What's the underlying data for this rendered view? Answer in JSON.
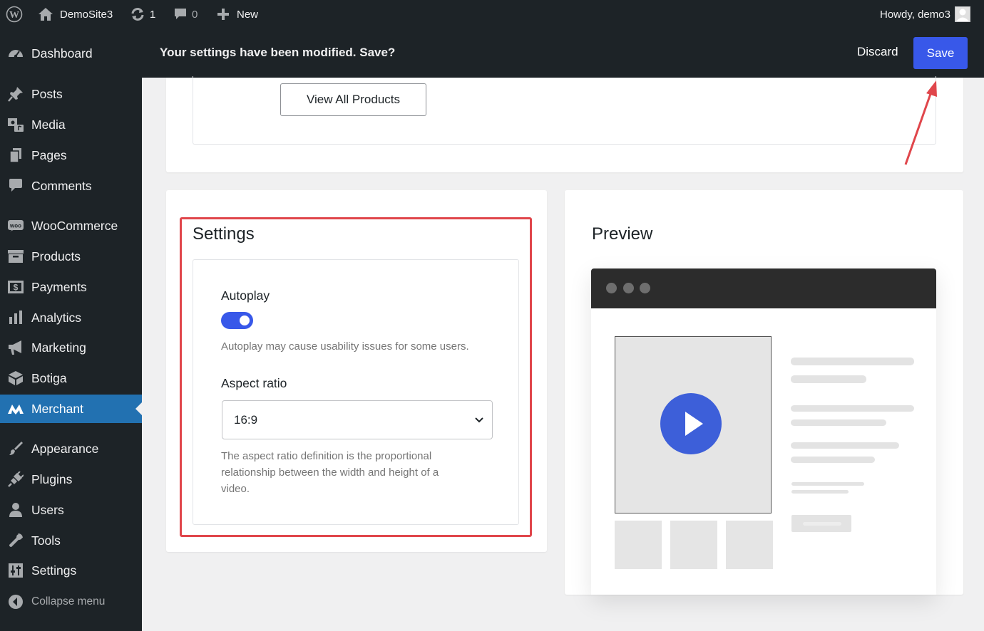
{
  "admin_bar": {
    "site_name": "DemoSite3",
    "updates_count": "1",
    "comments_count": "0",
    "new_label": "New",
    "greeting": "Howdy, demo3"
  },
  "sidebar": {
    "items": [
      {
        "label": "Dashboard",
        "icon": "dashboard-icon"
      },
      {
        "label": "Posts",
        "icon": "pin-icon"
      },
      {
        "label": "Media",
        "icon": "media-icon"
      },
      {
        "label": "Pages",
        "icon": "pages-icon"
      },
      {
        "label": "Comments",
        "icon": "comment-icon"
      },
      {
        "label": "WooCommerce",
        "icon": "woo-icon"
      },
      {
        "label": "Products",
        "icon": "archive-icon"
      },
      {
        "label": "Payments",
        "icon": "dollar-icon"
      },
      {
        "label": "Analytics",
        "icon": "bar-chart-icon"
      },
      {
        "label": "Marketing",
        "icon": "megaphone-icon"
      },
      {
        "label": "Botiga",
        "icon": "cube-icon"
      },
      {
        "label": "Merchant",
        "icon": "merchant-logo-icon",
        "active": true
      },
      {
        "label": "Appearance",
        "icon": "brush-icon"
      },
      {
        "label": "Plugins",
        "icon": "plug-icon"
      },
      {
        "label": "Users",
        "icon": "user-icon"
      },
      {
        "label": "Tools",
        "icon": "wrench-icon"
      },
      {
        "label": "Settings",
        "icon": "sliders-icon"
      }
    ],
    "collapse_label": "Collapse menu"
  },
  "notice": {
    "message": "Your settings have been modified. Save?",
    "discard_label": "Discard",
    "save_label": "Save"
  },
  "top_card": {
    "view_all_label": "View All Products"
  },
  "settings": {
    "title": "Settings",
    "autoplay_label": "Autoplay",
    "autoplay_enabled": true,
    "autoplay_help": "Autoplay may cause usability issues for some users.",
    "aspect_label": "Aspect ratio",
    "aspect_value": "16:9",
    "aspect_help_lines": [
      "The aspect ratio definition is the proportional",
      "relationship between the width and height of a",
      "video."
    ]
  },
  "preview": {
    "title": "Preview"
  },
  "colors": {
    "accent": "#3858e9",
    "admin_dark": "#1d2327",
    "active_menu": "#2271b1",
    "highlight": "#e0464b",
    "play_button": "#3d5fd9"
  }
}
